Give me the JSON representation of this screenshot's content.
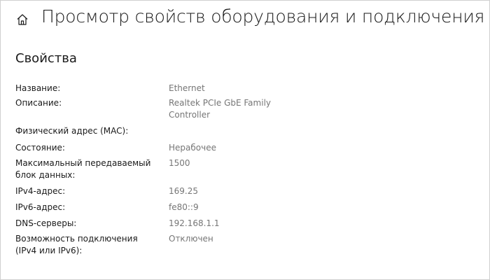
{
  "header": {
    "title": "Просмотр свойств оборудования и подключения"
  },
  "section": {
    "title": "Свойства"
  },
  "properties": [
    {
      "label": "Название:",
      "value": "Ethernet"
    },
    {
      "label": "Описание:",
      "value": "Realtek PCIe GbE Family Controller"
    },
    {
      "label": "Физический адрес (MAC):",
      "value": ""
    },
    {
      "label": "Состояние:",
      "value": "Нерабочее"
    },
    {
      "label": "Максимальный передаваемый блок данных:",
      "value": "1500"
    },
    {
      "label": "IPv4-адрес:",
      "value": "169.25"
    },
    {
      "label": "IPv6-адрес:",
      "value": "fe80::9"
    },
    {
      "label": "DNS-серверы:",
      "value": "192.168.1.1"
    },
    {
      "label": "Возможность подключения (IPv4 или IPv6):",
      "value": "Отключен"
    }
  ],
  "icons": {
    "home": "home-icon"
  }
}
